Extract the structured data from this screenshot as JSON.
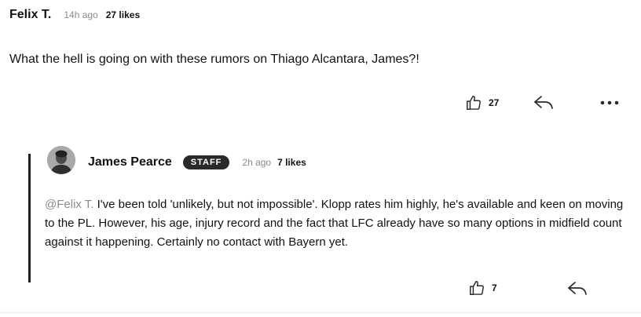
{
  "comment": {
    "author": "Felix T.",
    "time": "14h ago",
    "likes_label": "27 likes",
    "text": "What the hell is going on with these rumors on Thiago Alcantara, James?!",
    "like_count": "27",
    "icons": [
      "thumbs-up-icon",
      "reply-arrow-icon",
      "more-options-icon"
    ]
  },
  "reply": {
    "author": "James Pearce",
    "badge": "STAFF",
    "time": "2h ago",
    "likes_label": "7 likes",
    "mention": "@Felix T.",
    "text": " I've been told 'unlikely, but not impossible'. Klopp rates him highly, he's available and keen on moving to the PL. However, his age, injury record and the fact that LFC already have so many options in midfield count against it happening. Certainly no contact with Bayern yet.",
    "like_count": "7",
    "icons": [
      "avatar",
      "thumbs-up-icon",
      "reply-arrow-icon"
    ]
  },
  "colors": {
    "text": "#121212",
    "muted": "#8a8a8a",
    "badge_bg": "#2a2a2a",
    "thread_line": "#1f1f1f"
  }
}
